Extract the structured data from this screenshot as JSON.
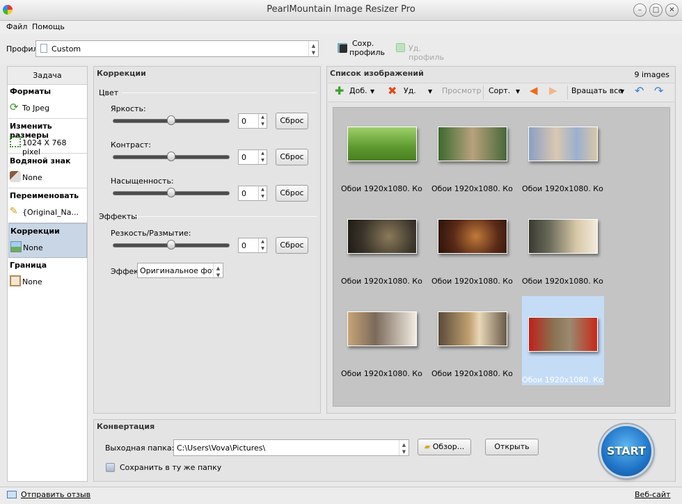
{
  "window": {
    "title": "PearlMountain Image Resizer Pro"
  },
  "menu": {
    "file": "Файл",
    "help": "Помощь"
  },
  "profile": {
    "label": "Профиль",
    "value": "Custom",
    "save_label_1": "Сохр.",
    "save_label_2": "профиль",
    "delete_label": "Уд. профиль"
  },
  "tasks": {
    "header": "Задача",
    "items": [
      {
        "title": "Форматы",
        "value": "To Jpeg",
        "icon": "convert-icon"
      },
      {
        "title": "Изменить размеры",
        "value": "1024 X 768 pixel",
        "icon": "resize-icon"
      },
      {
        "title": "Водяной знак",
        "value": "None",
        "icon": "watermark-icon"
      },
      {
        "title": "Переименовать",
        "value": "{Original_Na...",
        "icon": "pencil-icon"
      },
      {
        "title": "Коррекции",
        "value": "None",
        "icon": "corrections-icon",
        "selected": true
      },
      {
        "title": "Граница",
        "value": "None",
        "icon": "border-icon"
      }
    ]
  },
  "corrections": {
    "title": "Коррекции",
    "color_group": "Цвет",
    "brightness": {
      "label": "Яркость:",
      "value": "0",
      "level": 0.5
    },
    "contrast": {
      "label": "Контраст:",
      "value": "0",
      "level": 0.5
    },
    "saturation": {
      "label": "Насыщенность:",
      "value": "0",
      "level": 0.5
    },
    "effects_group": "Эффекты",
    "sharpness": {
      "label": "Резкость/Размытие:",
      "value": "0",
      "level": 0.5
    },
    "effect": {
      "label": "Эффект",
      "value": "Оригинальное фото"
    },
    "reset_label": "Сброс"
  },
  "image_list": {
    "title": "Список изображений",
    "count": "9 images",
    "toolbar": {
      "add": "Доб.",
      "remove": "Уд.",
      "preview": "Просмотр",
      "sort": "Сорт.",
      "rotate_all": "Вращать все"
    },
    "items": [
      {
        "caption": "Обои 1920x1080. Ко..."
      },
      {
        "caption": "Обои 1920x1080. Ко..."
      },
      {
        "caption": "Обои 1920x1080. Ко..."
      },
      {
        "caption": "Обои 1920x1080. Ко..."
      },
      {
        "caption": "Обои 1920x1080. Ко..."
      },
      {
        "caption": "Обои 1920x1080. Ко..."
      },
      {
        "caption": "Обои 1920x1080. Ко..."
      },
      {
        "caption": "Обои 1920x1080. Ко..."
      },
      {
        "caption": "Обои 1920x1080. Ко...",
        "selected": true
      }
    ]
  },
  "conversion": {
    "title": "Конвертация",
    "output_label": "Выходная папка:",
    "output_value": "C:\\Users\\Vova\\Pictures\\",
    "browse_label": "Обзор...",
    "open_label": "Открыть",
    "same_folder_label": "Сохранить в ту же папку",
    "start_label": "START"
  },
  "status": {
    "feedback": "Отправить отзыв",
    "website": "Веб-сайт"
  }
}
